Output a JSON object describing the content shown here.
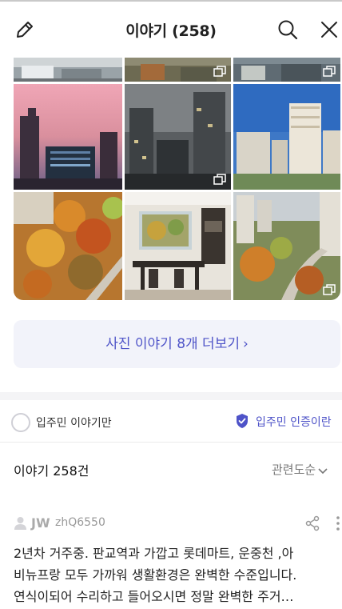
{
  "header": {
    "title": "이야기 (258)",
    "edit_icon": "pencil-icon",
    "search_icon": "search-icon",
    "close_icon": "close-icon"
  },
  "gallery": {
    "photos": [
      {
        "subject": "apartment rooftops (cropped)",
        "multi": false
      },
      {
        "subject": "apartment rooftops (cropped)",
        "multi": true
      },
      {
        "subject": "apartment rooftops (cropped)",
        "multi": true
      },
      {
        "subject": "sunset over apartment towers",
        "multi": false
      },
      {
        "subject": "foggy night apartment towers",
        "multi": true
      },
      {
        "subject": "blue sky apartment towers",
        "multi": false
      },
      {
        "subject": "autumn trees between apartments",
        "multi": false
      },
      {
        "subject": "dining room with window view",
        "multi": false
      },
      {
        "subject": "autumn park between towers",
        "multi": true
      }
    ]
  },
  "more_photos": {
    "label": "사진 이야기 8개 더보기",
    "chevron": "›"
  },
  "filter": {
    "resident_only_label": "입주민 이야기만",
    "verify_link_label": "입주민 인증이란",
    "verify_icon": "verified-badge-icon"
  },
  "list": {
    "count_label": "이야기 258건",
    "sort_label": "관련도순",
    "sort_chevron": "⌄"
  },
  "post": {
    "author_initial": "JW",
    "author_id": "zhQ6550",
    "share_icon": "share-icon",
    "more_icon": "kebab-icon",
    "body_lines": [
      "2년차 거주중. 판교역과 가깝고 롯데마트, 운중천 ,아",
      "비뉴프랑 모두 가까워 생활환경은 완벽한 수준입니다.",
      "연식이되어 수리하고 들어오시면 정말 완벽한 주거…"
    ]
  },
  "colors": {
    "accent": "#4e53c8",
    "more_button_bg": "#f2f3fa",
    "divider": "#f4f4f6"
  }
}
